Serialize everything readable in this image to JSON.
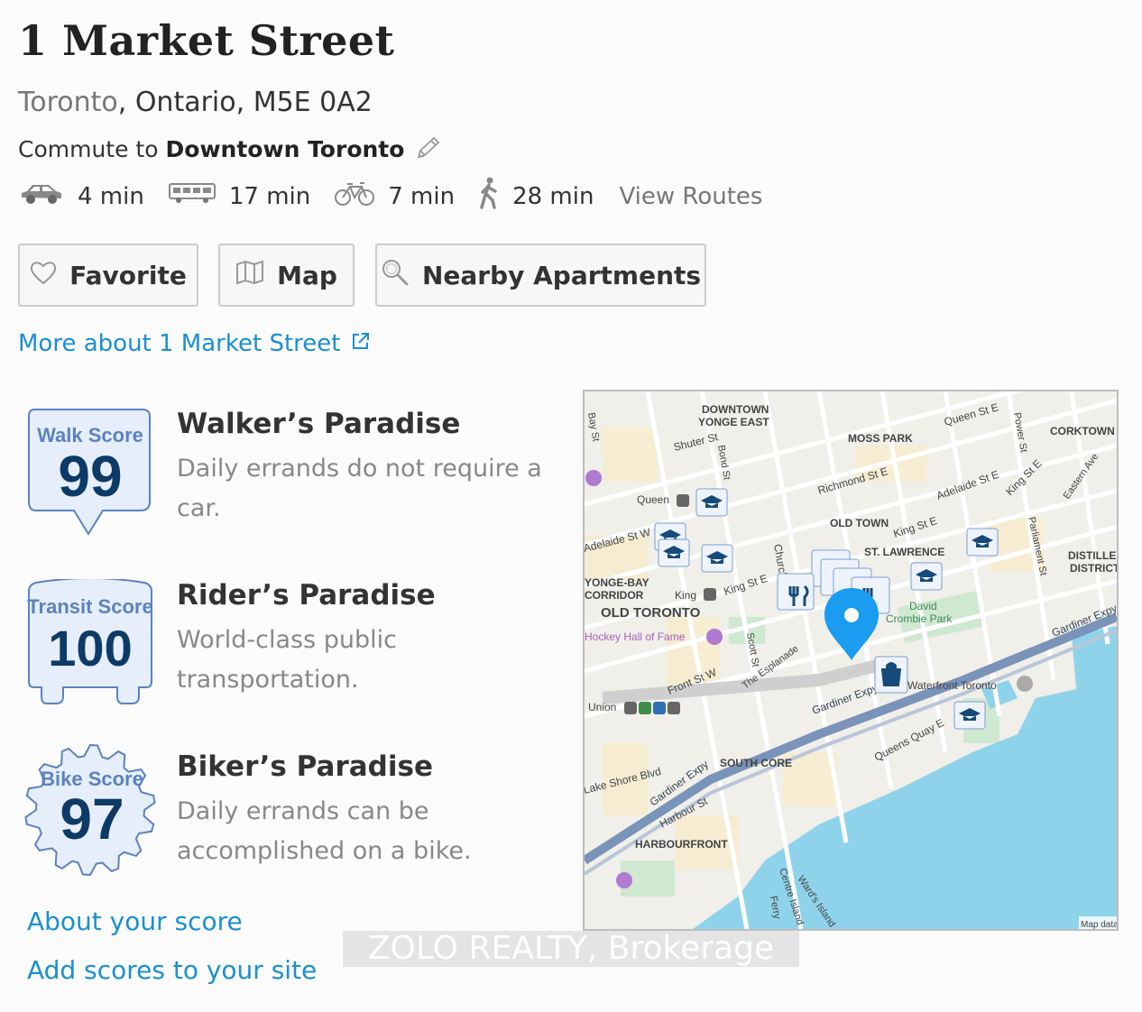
{
  "listing": {
    "title": "1 Market Street",
    "city": "Toronto",
    "region": ", Ontario, M5E 0A2"
  },
  "commute": {
    "prefix": "Commute to",
    "destination": "Downtown Toronto",
    "modes": [
      {
        "icon": "car-icon",
        "time": "4 min"
      },
      {
        "icon": "bus-icon",
        "time": "17 min"
      },
      {
        "icon": "bike-icon",
        "time": "7 min"
      },
      {
        "icon": "walk-icon",
        "time": "28 min"
      }
    ],
    "view_routes": "View Routes"
  },
  "buttons": {
    "favorite": "Favorite",
    "map": "Map",
    "nearby": "Nearby Apartments"
  },
  "more_link": "More about 1 Market Street",
  "scores": [
    {
      "badge_label": "Walk Score",
      "value": "99",
      "title": "Walker’s Paradise",
      "description": "Daily errands do not require a car."
    },
    {
      "badge_label": "Transit Score",
      "value": "100",
      "title": "Rider’s Paradise",
      "description": "World-class public transportation."
    },
    {
      "badge_label": "Bike Score",
      "value": "97",
      "title": "Biker’s Paradise",
      "description": "Daily errands can be accomplished on a bike."
    }
  ],
  "links": {
    "about": "About your score",
    "add": "Add scores to your site"
  },
  "map": {
    "labels": [
      "DOWNTOWN",
      "YONGE EAST",
      "Queen St E",
      "CORKTOWN",
      "Shuter St",
      "Bond St",
      "MOSS PARK",
      "Power St",
      "Bay St",
      "Richmond St E",
      "Adelaide St E",
      "King St E",
      "Eastern Ave",
      "Queen",
      "OLD TOWN",
      "King St E",
      "Parliament St",
      "Adelaide St W",
      "ST. LAWRENCE",
      "DISTILLERY",
      "DISTRICT",
      "Church",
      "King",
      "King St E",
      "YONGE-BAY",
      "CORRIDOR",
      "OLD TORONTO",
      "David",
      "Crombie Park",
      "Hockey Hall of Fame",
      "Scott St",
      "The Esplanade",
      "Front St W",
      "Gardiner Expy",
      "Union",
      "Waterfront Toronto",
      "Gardiner Expy",
      "Queens Quay E",
      "SOUTH CORE",
      "Lake Shore Blvd",
      "Gardiner Expy",
      "Harbour St",
      "HARBOURFRONT",
      "Centre Island",
      "Ward's Island",
      "Ferry",
      "Map data"
    ]
  },
  "watermark": "ZOLO REALTY, Brokerage",
  "colors": {
    "link": "#1a8fd1",
    "badge_fill": "#e6eefb",
    "badge_stroke": "#5b82c0",
    "badge_number": "#0d3a66",
    "water": "#8fd3ea",
    "pin": "#1a9cf0"
  }
}
